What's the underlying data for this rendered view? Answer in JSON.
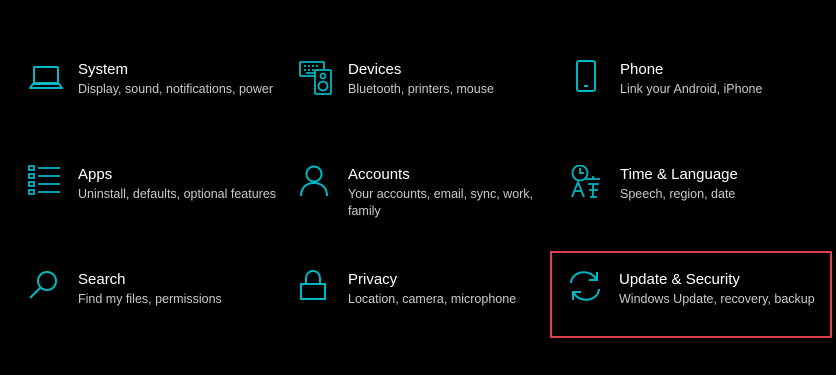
{
  "accent_color": "#00b7c3",
  "highlight_color": "#e1424a",
  "tiles": [
    {
      "icon": "laptop-icon",
      "title": "System",
      "desc": "Display, sound, notifications, power"
    },
    {
      "icon": "devices-icon",
      "title": "Devices",
      "desc": "Bluetooth, printers, mouse"
    },
    {
      "icon": "phone-icon",
      "title": "Phone",
      "desc": "Link your Android, iPhone"
    },
    {
      "icon": "apps-list-icon",
      "title": "Apps",
      "desc": "Uninstall, defaults, optional features"
    },
    {
      "icon": "person-icon",
      "title": "Accounts",
      "desc": "Your accounts, email, sync, work, family"
    },
    {
      "icon": "time-language-icon",
      "title": "Time & Language",
      "desc": "Speech, region, date"
    },
    {
      "icon": "search-icon",
      "title": "Search",
      "desc": "Find my files, permissions"
    },
    {
      "icon": "lock-icon",
      "title": "Privacy",
      "desc": "Location, camera, microphone"
    },
    {
      "icon": "sync-icon",
      "title": "Update & Security",
      "desc": "Windows Update, recovery, backup",
      "highlighted": true
    }
  ]
}
